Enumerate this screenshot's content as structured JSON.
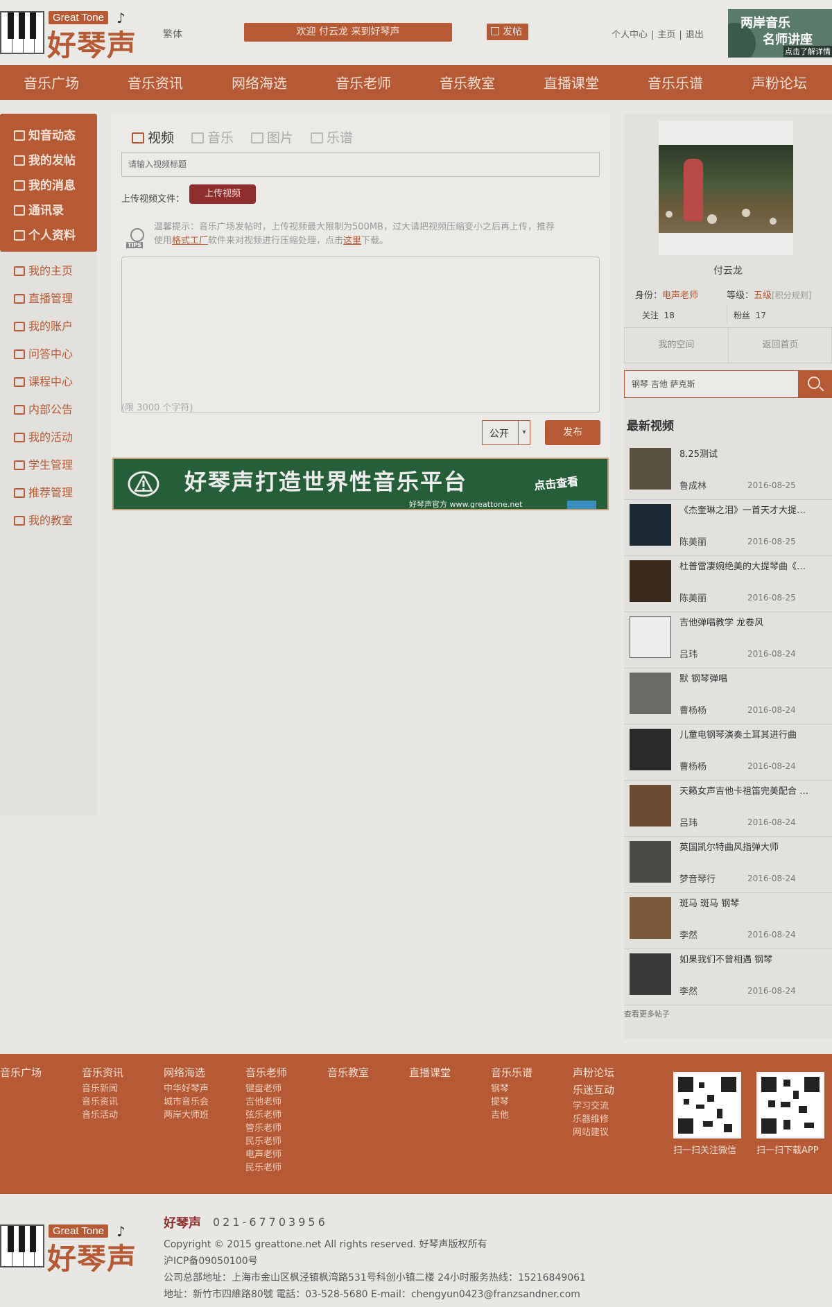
{
  "header": {
    "logo_en": "Great Tone",
    "logo_cn": "好琴声",
    "traditional_link": "繁体",
    "welcome": "欢迎 付云龙 来到好琴声",
    "post_label": "发帖",
    "links": [
      "个人中心",
      "主页",
      "退出"
    ],
    "ad": {
      "line1": "两岸音乐",
      "line2": "名师讲座",
      "line3": "点击了解详情"
    }
  },
  "nav": [
    "音乐广场",
    "音乐资讯",
    "网络海选",
    "音乐老师",
    "音乐教室",
    "直播课堂",
    "音乐乐谱",
    "声粉论坛"
  ],
  "sidebar": {
    "primary": [
      "知音动态",
      "我的发帖",
      "我的消息",
      "通讯录",
      "个人资料"
    ],
    "secondary": [
      "我的主页",
      "直播管理",
      "我的账户",
      "问答中心",
      "课程中心",
      "内部公告",
      "我的活动",
      "学生管理",
      "推荐管理",
      "我的教室"
    ]
  },
  "composer": {
    "tabs": [
      "视频",
      "音乐",
      "图片",
      "乐谱"
    ],
    "title_placeholder": "请输入视频标题",
    "upload_label": "上传视频文件：",
    "upload_button": "上传视频",
    "tips_badge": "TIPS",
    "tips_line1": "温馨提示：音乐广场发帖时，上传视频最大限制为500MB，过大请把视频压缩变小之后再上传，推荐",
    "tips_line2_a": "使用",
    "tips_link1": "格式工厂",
    "tips_line2_b": "软件来对视频进行压缩处理，点击",
    "tips_link2": "这里",
    "tips_line2_c": "下载。",
    "content_limit": "(限 3000 个字符)",
    "privacy": "公开",
    "publish_button": "发布"
  },
  "banner": {
    "title": "好琴声打造世界性音乐平台",
    "subtitle": "好琴声官方 www.greattone.net",
    "cta": "点击查看"
  },
  "profile": {
    "name": "付云龙",
    "identity_label": "身份：",
    "identity": "电声老师",
    "level_label": "等级：",
    "level": "五级",
    "level_rule": "[积分规则]",
    "follow_label": "关注",
    "follow": "18",
    "fans_label": "粉丝",
    "fans": "17",
    "my_space": "我的空间",
    "back_home": "返回首页"
  },
  "search": {
    "value": "钢琴 吉他 萨克斯"
  },
  "latest": {
    "title": "最新视频",
    "items": [
      {
        "title": "8.25测试",
        "author": "鲁成林",
        "date": "2016-08-25"
      },
      {
        "title": "《杰奎琳之泪》一首天才大提…",
        "author": "陈美丽",
        "date": "2016-08-25"
      },
      {
        "title": "杜普雷凄婉绝美的大提琴曲《…",
        "author": "陈美丽",
        "date": "2016-08-25"
      },
      {
        "title": "吉他弹唱教学 龙卷风",
        "author": "吕玮",
        "date": "2016-08-24"
      },
      {
        "title": "默 钢琴弹唱",
        "author": "曹杨杨",
        "date": "2016-08-24"
      },
      {
        "title": "儿童电钢琴演奏土耳其进行曲",
        "author": "曹杨杨",
        "date": "2016-08-24"
      },
      {
        "title": "天籁女声吉他卡祖笛完美配合 …",
        "author": "吕玮",
        "date": "2016-08-24"
      },
      {
        "title": "英国凯尔特曲风指弹大师",
        "author": "梦音琴行",
        "date": "2016-08-24"
      },
      {
        "title": "斑马 斑马 钢琴",
        "author": "李然",
        "date": "2016-08-24"
      },
      {
        "title": "如果我们不曾相遇 钢琴",
        "author": "李然",
        "date": "2016-08-24"
      }
    ],
    "more": "查看更多帖子"
  },
  "footer": {
    "cols": [
      {
        "head": "音乐广场",
        "subs": []
      },
      {
        "head": "音乐资讯",
        "subs": [
          "音乐新闻",
          "音乐资讯",
          "音乐活动"
        ]
      },
      {
        "head": "网络海选",
        "subs": [
          "中华好琴声",
          "城市音乐会",
          "两岸大师班"
        ]
      },
      {
        "head": "音乐老师",
        "subs": [
          "键盘老师",
          "吉他老师",
          "弦乐老师",
          "管乐老师",
          "民乐老师",
          "电声老师",
          "民乐老师"
        ]
      },
      {
        "head": "音乐教室",
        "subs": []
      },
      {
        "head": "直播课堂",
        "subs": []
      },
      {
        "head": "音乐乐谱",
        "subs": [
          "钢琴",
          "提琴",
          "吉他"
        ]
      },
      {
        "head": "声粉论坛",
        "subs": [],
        "head2": "乐迷互动",
        "subs2": [
          "学习交流",
          "乐器维修",
          "网站建议"
        ]
      }
    ],
    "qr_wechat": "扫一扫关注微信",
    "qr_app": "扫一扫下载APP"
  },
  "bottom": {
    "brand": "好琴声",
    "phone": "021-67703956",
    "copyright": "Copyright © 2015 greattone.net All rights reserved. 好琴声版权所有",
    "icp": "沪ICP备09050100号",
    "address1": "公司总部地址：上海市金山区枫泾镇枫湾路531号科创小镇二楼 24小时服务热线：15216849061",
    "address2": "地址：新竹市四維路80號 電話：03-528-5680 E-mail：chengyun0423@franzsandner.com"
  },
  "colors": {
    "brand": "#b65a35",
    "upload": "#8e2e2e",
    "banner": "#275e3a"
  }
}
